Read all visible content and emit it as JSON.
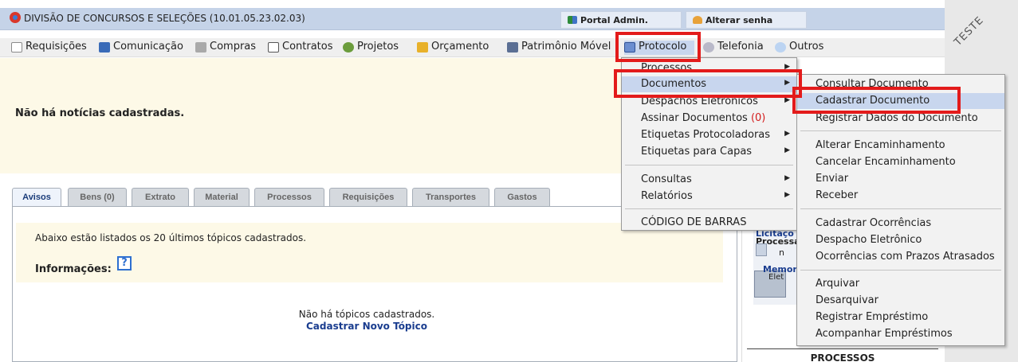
{
  "header": {
    "unit_title": "DIVISÃO DE CONCURSOS E SELEÇÕES (10.01.05.23.02.03)",
    "portal_label": "Portal Admin.",
    "password_label": "Alterar senha",
    "teste_label": "TESTE"
  },
  "menubar": {
    "items": [
      {
        "label": "Requisições",
        "icon": "document-icon"
      },
      {
        "label": "Comunicação",
        "icon": "book-icon"
      },
      {
        "label": "Compras",
        "icon": "cart-icon"
      },
      {
        "label": "Contratos",
        "icon": "contract-icon"
      },
      {
        "label": "Projetos",
        "icon": "projects-icon"
      },
      {
        "label": "Orçamento",
        "icon": "budget-icon"
      },
      {
        "label": "Patrimônio Móvel",
        "icon": "asset-icon"
      },
      {
        "label": "Protocolo",
        "icon": "protocol-icon"
      },
      {
        "label": "Telefonia",
        "icon": "phone-icon"
      },
      {
        "label": "Outros",
        "icon": "search-icon"
      }
    ]
  },
  "news": {
    "empty_text": "Não há notícias cadastradas."
  },
  "tabs": [
    {
      "label": "Avisos"
    },
    {
      "label": "Bens (0)"
    },
    {
      "label": "Extrato"
    },
    {
      "label": "Material"
    },
    {
      "label": "Processos"
    },
    {
      "label": "Requisições"
    },
    {
      "label": "Transportes"
    },
    {
      "label": "Gastos"
    }
  ],
  "panel": {
    "intro_text": "Abaixo estão listados os 20 últimos tópicos cadastrados.",
    "info_label": "Informações:",
    "help_glyph": "?",
    "no_topics_text": "Não há tópicos cadastrados.",
    "new_topic_link": "Cadastrar Novo Tópico"
  },
  "right_panel": {
    "line1": "Licitaçõ",
    "line2": "Processa",
    "line3": "n",
    "line4": "Memor",
    "line5": "Elet",
    "processos_title": "PROCESSOS"
  },
  "protocolo_menu": {
    "items": [
      {
        "label": "Processos",
        "has_submenu": true
      },
      {
        "label": "Documentos",
        "has_submenu": true
      },
      {
        "label": "Despachos Eletrônicos",
        "has_submenu": true
      },
      {
        "label": "Assinar Documentos",
        "count": "(0)",
        "has_submenu": false
      },
      {
        "label": "Etiquetas Protocoladoras",
        "has_submenu": true
      },
      {
        "label": "Etiquetas para Capas",
        "has_submenu": true
      },
      {
        "label": "Consultas",
        "has_submenu": true
      },
      {
        "label": "Relatórios",
        "has_submenu": true
      },
      {
        "label": "CÓDIGO DE BARRAS",
        "has_submenu": false
      }
    ],
    "submenu_arrow": "▶"
  },
  "documentos_submenu": {
    "items": [
      {
        "label": "Consultar Documento"
      },
      {
        "label": "Cadastrar Documento"
      },
      {
        "label": "Registrar Dados do Documento"
      },
      {
        "label": "Alterar Encaminhamento"
      },
      {
        "label": "Cancelar Encaminhamento"
      },
      {
        "label": "Enviar"
      },
      {
        "label": "Receber"
      },
      {
        "label": "Cadastrar Ocorrências"
      },
      {
        "label": "Despacho Eletrônico"
      },
      {
        "label": "Ocorrências com Prazos Atrasados"
      },
      {
        "label": "Arquivar"
      },
      {
        "label": "Desarquivar"
      },
      {
        "label": "Registrar Empréstimo"
      },
      {
        "label": "Acompanhar Empréstimos"
      }
    ]
  },
  "colors": {
    "highlight": "#e31b1b",
    "header_bg": "#c5d3e8",
    "menu_selected": "#c8d6ee",
    "link_blue": "#1a3d8f"
  }
}
